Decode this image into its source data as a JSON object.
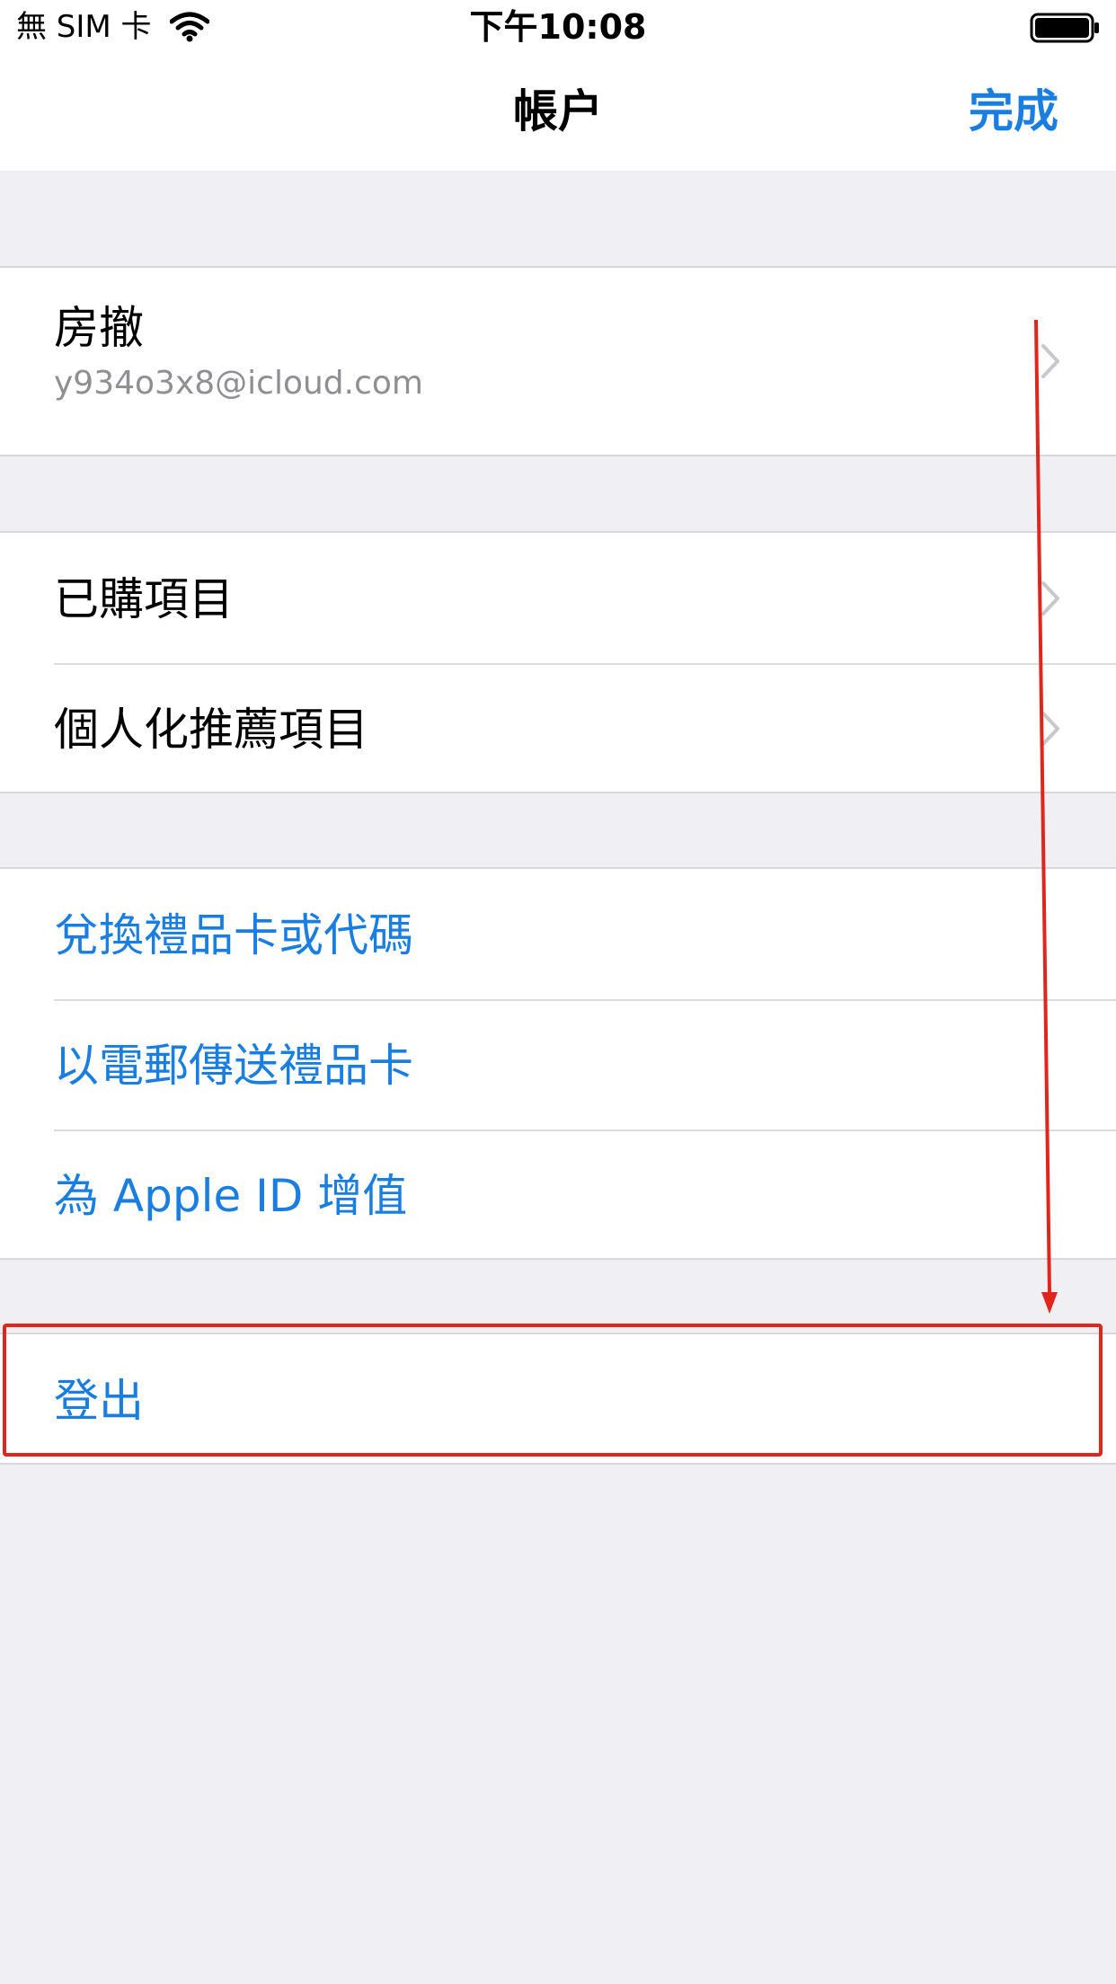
{
  "status_bar": {
    "carrier": "無 SIM 卡",
    "time": "下午10:08"
  },
  "nav": {
    "title": "帳户",
    "done_label": "完成"
  },
  "account": {
    "name": "房撤",
    "email": "y934o3x8@icloud.com"
  },
  "purchases_group": {
    "items": [
      {
        "label": "已購項目"
      },
      {
        "label": "個人化推薦項目"
      }
    ]
  },
  "gift_group": {
    "items": [
      {
        "label": "兌換禮品卡或代碼"
      },
      {
        "label": "以電郵傳送禮品卡"
      },
      {
        "label": "為 Apple ID 增值"
      }
    ]
  },
  "sign_out": {
    "label": "登出"
  },
  "colors": {
    "accent": "#1a7ee0",
    "background": "#efeff4",
    "annotation": "#e0261c"
  }
}
